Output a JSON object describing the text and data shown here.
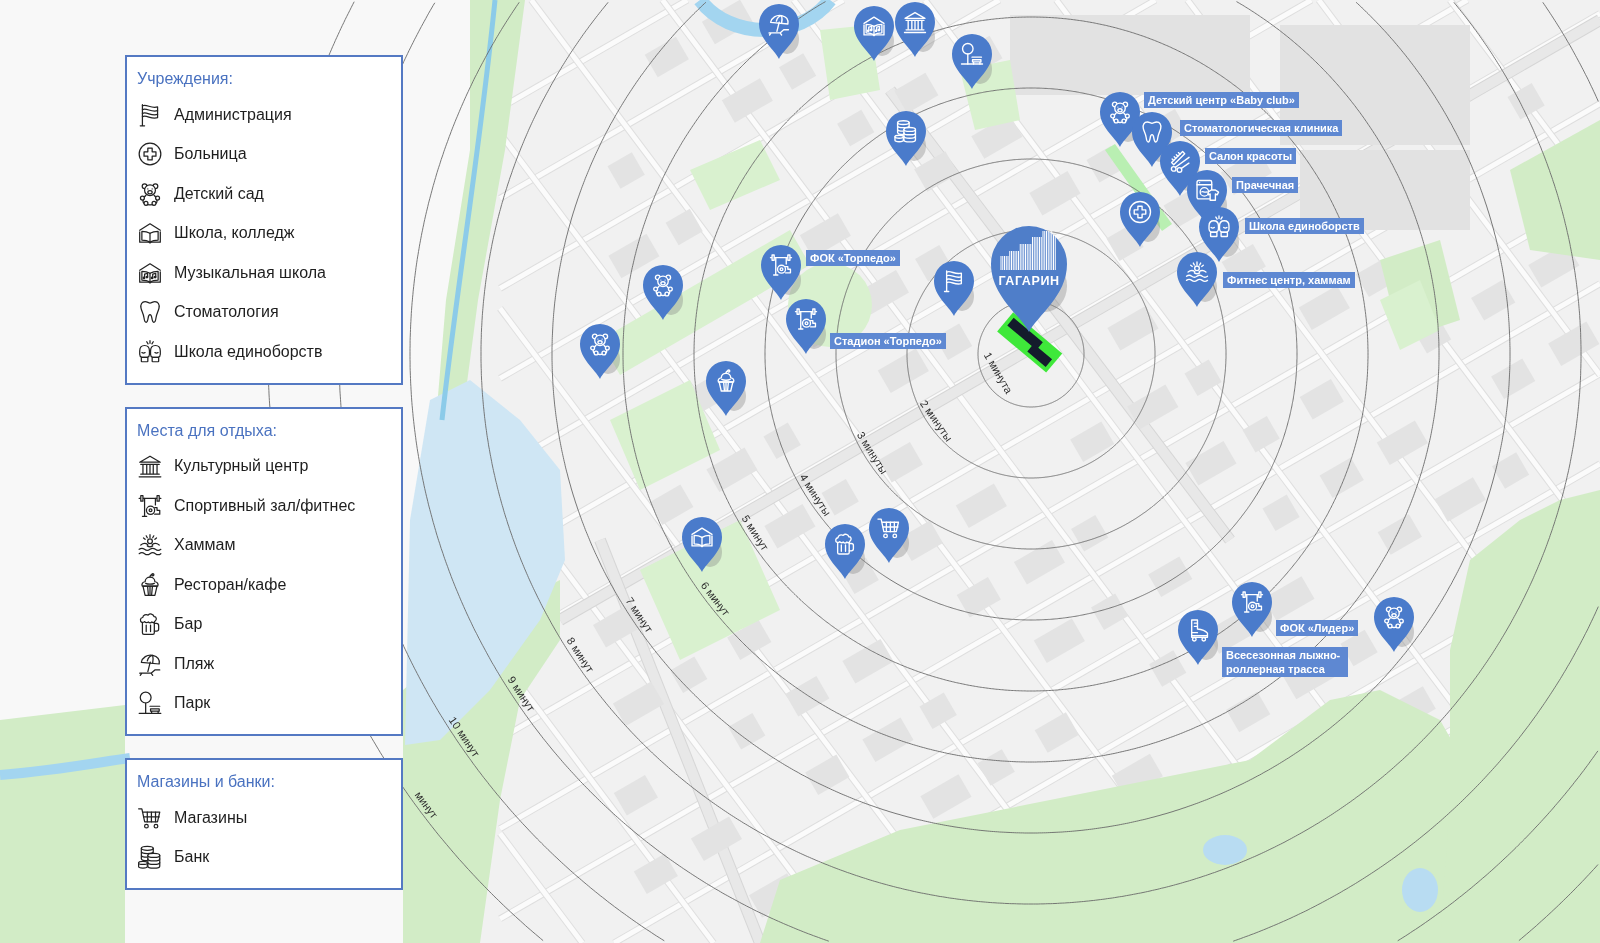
{
  "legend": [
    {
      "title": "Учреждения:",
      "items": [
        {
          "kind": "admin",
          "label": "Администрация"
        },
        {
          "kind": "hospital",
          "label": "Больница"
        },
        {
          "kind": "kindergarten",
          "label": "Детский сад"
        },
        {
          "kind": "school",
          "label": "Школа, колледж"
        },
        {
          "kind": "musicschool",
          "label": "Музыкальная школа"
        },
        {
          "kind": "dentistry",
          "label": "Стоматология"
        },
        {
          "kind": "martialarts",
          "label": "Школа единоборств"
        }
      ]
    },
    {
      "title": "Места для отдыха:",
      "items": [
        {
          "kind": "culture",
          "label": "Культурный центр"
        },
        {
          "kind": "gym",
          "label": "Спортивный зал/фитнес"
        },
        {
          "kind": "hammam",
          "label": "Хаммам"
        },
        {
          "kind": "restaurant",
          "label": "Ресторан/кафе"
        },
        {
          "kind": "bar",
          "label": "Бар"
        },
        {
          "kind": "beach",
          "label": "Пляж"
        },
        {
          "kind": "park",
          "label": "Парк"
        }
      ]
    },
    {
      "title": "Магазины и банки:",
      "items": [
        {
          "kind": "shop",
          "label": "Магазины"
        },
        {
          "kind": "bank",
          "label": "Банк"
        }
      ]
    }
  ],
  "map": {
    "rings": [
      {
        "label": "1 минута"
      },
      {
        "label": "2 минуты"
      },
      {
        "label": "3 минуты"
      },
      {
        "label": "4 минуты"
      },
      {
        "label": "5 минут"
      },
      {
        "label": "6 минут"
      },
      {
        "label": "7 минут"
      },
      {
        "label": "8 минут"
      },
      {
        "label": "9 минут"
      },
      {
        "label": "10 минут"
      },
      {
        "label": "минут"
      }
    ],
    "pins": [
      {
        "kind": "beach"
      },
      {
        "kind": "musicschool"
      },
      {
        "kind": "culture"
      },
      {
        "kind": "park"
      },
      {
        "kind": "kindergarten",
        "label": "Детский центр «Baby club»"
      },
      {
        "kind": "dentistry",
        "label": "Стоматологическая клиника"
      },
      {
        "kind": "bank"
      },
      {
        "kind": "salon",
        "label": "Салон красоты"
      },
      {
        "kind": "laundry",
        "label": "Прачечная"
      },
      {
        "kind": "hospital"
      },
      {
        "kind": "martialarts",
        "label": "Школа единоборств"
      },
      {
        "kind": "gym",
        "label": "ФОК «Торпедо»"
      },
      {
        "kind": "kindergarten"
      },
      {
        "kind": "admin"
      },
      {
        "kind": "hammam",
        "label": "Фитнес центр, хаммам"
      },
      {
        "kind": "gym",
        "label": "Стадион «Торпедо»"
      },
      {
        "kind": "kindergarten"
      },
      {
        "kind": "restaurant"
      },
      {
        "kind": "shop"
      },
      {
        "kind": "bar"
      },
      {
        "kind": "school"
      },
      {
        "kind": "gym",
        "label": "ФОК «Лидер»"
      },
      {
        "kind": "kindergarten"
      },
      {
        "kind": "rollerski",
        "label": "Всесезонная лыжно-роллерная трасса"
      }
    ],
    "project_pin": {
      "logo_text": "ГАГАРИН"
    }
  }
}
